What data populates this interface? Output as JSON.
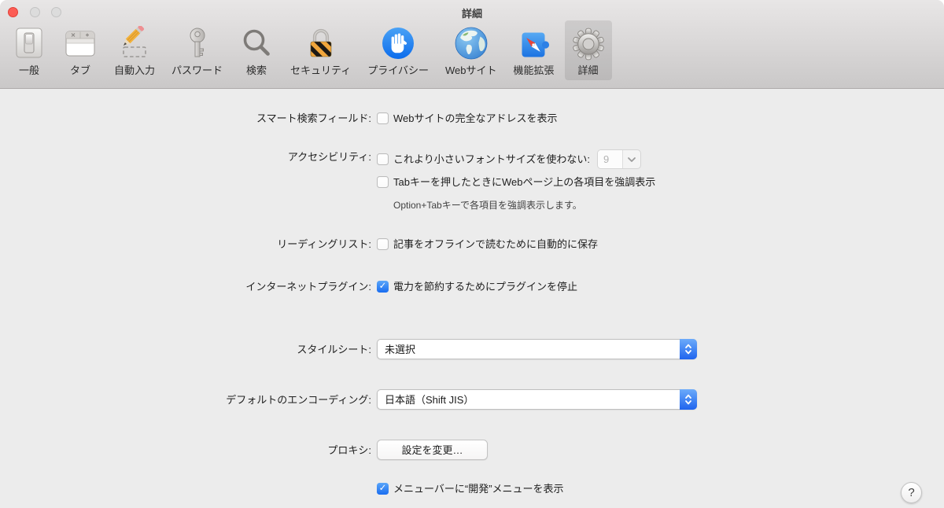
{
  "window": {
    "title": "詳細"
  },
  "toolbar": {
    "items": [
      {
        "label": "一般",
        "icon": "light-switch-icon",
        "selected": false
      },
      {
        "label": "タブ",
        "icon": "tabs-window-icon",
        "selected": false
      },
      {
        "label": "自動入力",
        "icon": "pencil-icon",
        "selected": false
      },
      {
        "label": "パスワード",
        "icon": "key-icon",
        "selected": false
      },
      {
        "label": "検索",
        "icon": "magnifier-icon",
        "selected": false
      },
      {
        "label": "セキュリティ",
        "icon": "padlock-icon",
        "selected": false
      },
      {
        "label": "プライバシー",
        "icon": "hand-icon",
        "selected": false
      },
      {
        "label": "Webサイト",
        "icon": "globe-icon",
        "selected": false
      },
      {
        "label": "機能拡張",
        "icon": "puzzle-icon",
        "selected": false
      },
      {
        "label": "詳細",
        "icon": "gear-icon",
        "selected": true
      }
    ]
  },
  "rows": {
    "smart_search": {
      "label": "スマート検索フィールド:",
      "checkbox": {
        "checked": false,
        "label": "Webサイトの完全なアドレスを表示"
      }
    },
    "accessibility": {
      "label": "アクセシビリティ:",
      "font_size_checkbox": {
        "checked": false,
        "label": "これより小さいフォントサイズを使わない:"
      },
      "font_size_value": "9",
      "tab_highlight_checkbox": {
        "checked": false,
        "label": "Tabキーを押したときにWebページ上の各項目を強調表示"
      },
      "note": "Option+Tabキーで各項目を強調表示します。"
    },
    "reading_list": {
      "label": "リーディングリスト:",
      "checkbox": {
        "checked": false,
        "label": "記事をオフラインで読むために自動的に保存"
      }
    },
    "plugins": {
      "label": "インターネットプラグイン:",
      "checkbox": {
        "checked": true,
        "label": "電力を節約するためにプラグインを停止"
      }
    },
    "stylesheet": {
      "label": "スタイルシート:",
      "value": "未選択"
    },
    "encoding": {
      "label": "デフォルトのエンコーディング:",
      "value": "日本語（Shift JIS）"
    },
    "proxy": {
      "label": "プロキシ:",
      "button_label": "設定を変更…"
    },
    "dev_menu": {
      "checkbox": {
        "checked": true,
        "label": "メニューバーに“開発”メニューを表示"
      }
    }
  },
  "help": {
    "label": "?"
  },
  "colors": {
    "accent_blue": "#2e7bf6",
    "toolbar_selected": "rgba(0,0,0,0.085)",
    "content_bg": "#ececec",
    "close_light": "#fc5d55"
  }
}
